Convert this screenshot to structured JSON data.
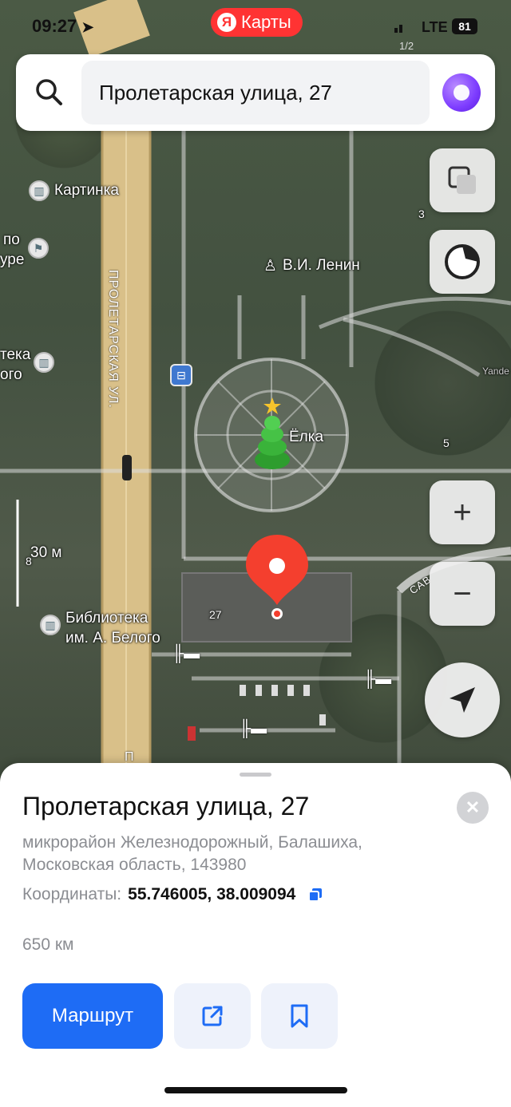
{
  "status": {
    "time": "09:27",
    "network": "LTE",
    "battery": "81",
    "page_indicator": "1/2"
  },
  "brand": {
    "logo": "Я",
    "name": "Карты"
  },
  "search": {
    "query": "Пролетарская улица, 27"
  },
  "map": {
    "street_label": "ПРОЛЕТАРСКАЯ УЛ.",
    "street_label_lower": "П",
    "side_street_label": "САВ",
    "pois": [
      {
        "name": "Картинка",
        "icon": "museum-icon"
      },
      {
        "name": "В.И. Ленин",
        "icon": "monument-icon"
      },
      {
        "name": "Ёлка",
        "icon": "christmas-tree-icon"
      },
      {
        "name": "Библиотека им. А. Белого",
        "line1": "Библиотека",
        "line2": "им. А. Белого",
        "icon": "library-icon"
      }
    ],
    "partial_labels": {
      "a": "по",
      "b": "уре",
      "c": "тека",
      "d": "ого"
    },
    "house_numbers": {
      "h3": "3",
      "h5": "5",
      "h8": "8",
      "h27": "27"
    },
    "scale": "30 м",
    "watermark": "Yande"
  },
  "controls": {
    "layers": "layers-icon",
    "style": "map-style-icon",
    "zoom_in": "+",
    "zoom_out": "−",
    "locate": "location-arrow-icon"
  },
  "card": {
    "title": "Пролетарская улица, 27",
    "address_line1": "микрорайон Железнодорожный, Балашиха,",
    "address_line2": "Московская область, 143980",
    "coords_label": "Координаты:",
    "coords_value": "55.746005, 38.009094",
    "distance": "650 км",
    "route_label": "Маршрут"
  },
  "colors": {
    "accent": "#1e6cf5",
    "pin": "#f43f2e",
    "brand": "#ff3333"
  }
}
